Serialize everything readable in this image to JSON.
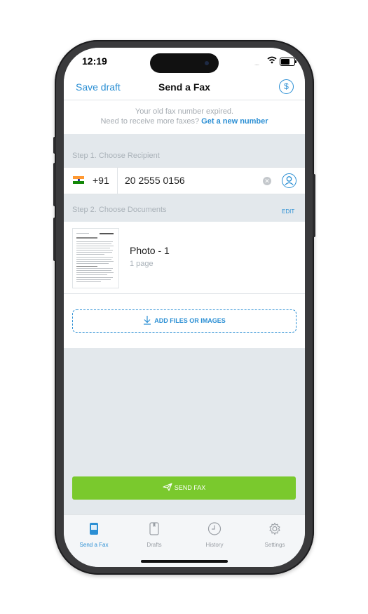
{
  "status_bar": {
    "time": "12:19",
    "signal": "....."
  },
  "nav": {
    "left": "Save draft",
    "title": "Send a Fax",
    "right_icon": "dollar-icon",
    "right_symbol": "$"
  },
  "notice": {
    "line1": "Your old fax number expired.",
    "line2_prefix": "Need to receive more faxes?",
    "line2_link": "Get a new number"
  },
  "step1": {
    "label": "Step 1. Choose Recipient",
    "country_code": "+91",
    "number": "20 2555 0156",
    "flag": "india-flag-icon"
  },
  "step2": {
    "label": "Step 2. Choose Documents",
    "edit_label": "EDIT",
    "documents": [
      {
        "name": "Photo - 1",
        "pages": "1 page"
      }
    ],
    "add_label": "ADD FILES OR IMAGES"
  },
  "send_label": "SEND FAX",
  "tabs": [
    {
      "label": "Send a Fax",
      "icon": "fax-icon",
      "active": true
    },
    {
      "label": "Drafts",
      "icon": "drafts-icon",
      "active": false
    },
    {
      "label": "History",
      "icon": "clock-icon",
      "active": false
    },
    {
      "label": "Settings",
      "icon": "gear-icon",
      "active": false
    }
  ],
  "colors": {
    "accent": "#2b8fd4",
    "send": "#7ac92d",
    "background": "#e3e8ec"
  }
}
